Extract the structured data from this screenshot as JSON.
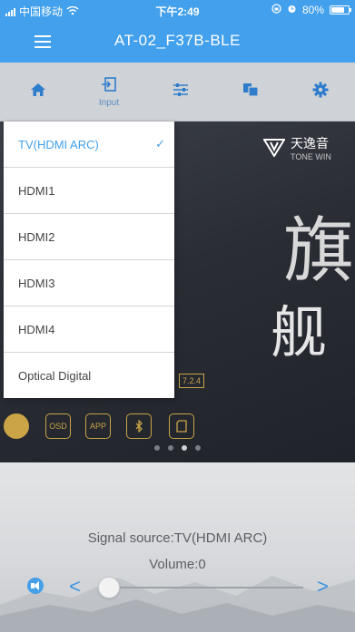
{
  "status_bar": {
    "carrier": "中国移动",
    "time": "下午2:49",
    "battery": "80%",
    "battery_level": 0.8
  },
  "nav": {
    "title": "AT-02_F37B-BLE",
    "menu_icon": "menu-icon"
  },
  "toolbar": {
    "items": [
      {
        "icon": "home-icon",
        "label": ""
      },
      {
        "icon": "input-icon",
        "label": "Input"
      },
      {
        "icon": "equalizer-icon",
        "label": ""
      },
      {
        "icon": "copy-icon",
        "label": ""
      },
      {
        "icon": "gear-icon",
        "label": ""
      }
    ]
  },
  "banner": {
    "logo_text": "天逸音",
    "logo_sub": "TONE WIN",
    "big1": "旗",
    "big2": "舰",
    "version": "7.2.4",
    "features": [
      "OSD",
      "APP"
    ]
  },
  "input_menu": {
    "options": [
      {
        "label": "TV(HDMI ARC)",
        "selected": true
      },
      {
        "label": "HDMI1",
        "selected": false
      },
      {
        "label": "HDMI2",
        "selected": false
      },
      {
        "label": "HDMI3",
        "selected": false
      },
      {
        "label": "HDMI4",
        "selected": false
      },
      {
        "label": "Optical Digital",
        "selected": false
      }
    ],
    "check_mark": "✓"
  },
  "player": {
    "signal_source": "Signal source:TV(HDMI ARC)",
    "volume": "Volume:0",
    "volume_level": 0,
    "prev_symbol": "<",
    "next_symbol": ">"
  },
  "colors": {
    "accent": "#42a0ec",
    "toolbar_bg": "#cfd2d6"
  }
}
